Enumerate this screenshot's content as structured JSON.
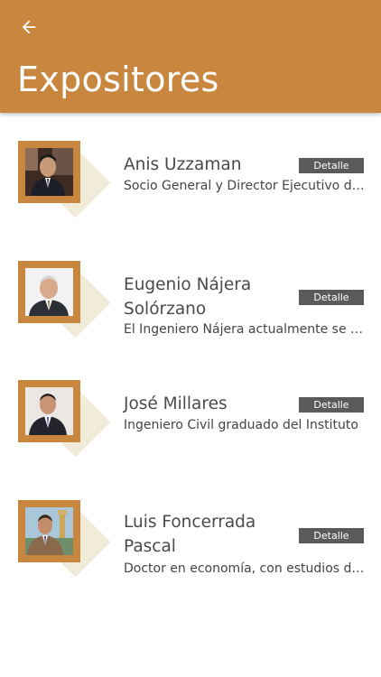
{
  "header": {
    "title": "Expositores",
    "back_icon": "arrow-left-icon"
  },
  "colors": {
    "primary": "#c9863f",
    "button": "#5a5a5a",
    "diamond": "#f1ebd9"
  },
  "speakers": [
    {
      "name": "Anis Uzzaman",
      "description": "Socio General y Director Ejecutivo de Pegasus Tech Ventures",
      "button_label": "Detalle"
    },
    {
      "name": "Eugenio Nájera Solórzano",
      "description": "El Ingeniero Nájera actualmente se desempeña como director",
      "button_label": "Detalle"
    },
    {
      "name": "José Millares",
      "description": "Ingeniero Civil graduado del Instituto",
      "button_label": "Detalle"
    },
    {
      "name": "Luis Foncerrada Pascal",
      "description": "Doctor en economía, con estudios de posgrado",
      "button_label": "Detalle"
    }
  ]
}
